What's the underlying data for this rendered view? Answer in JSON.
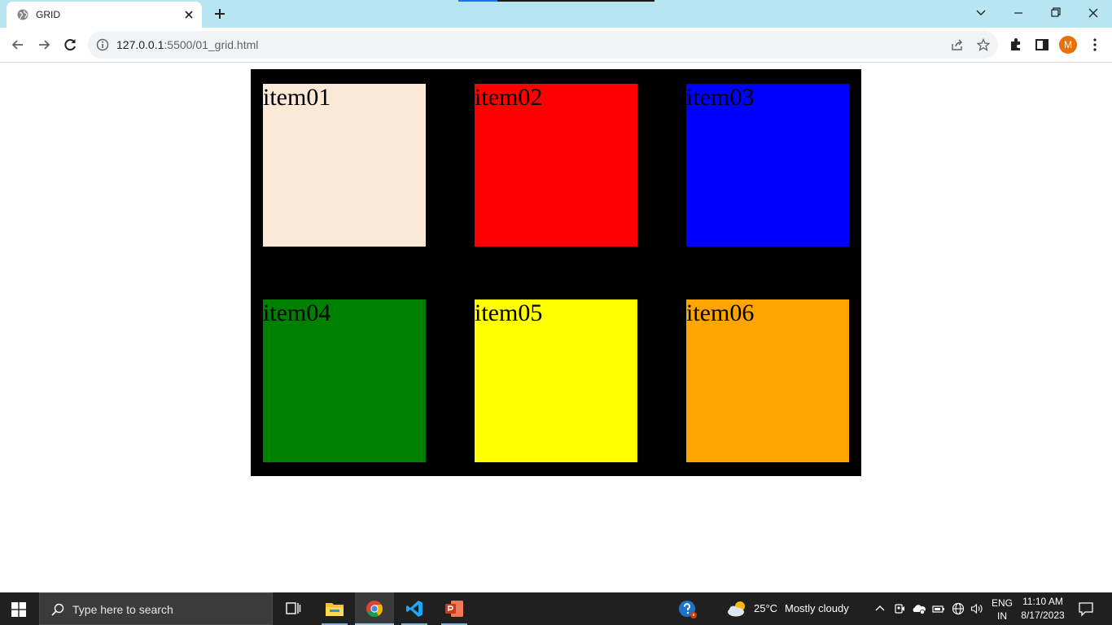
{
  "browser": {
    "tab_title": "GRID",
    "url_host": "127.0.0.1",
    "url_path": ":5500/01_grid.html",
    "profile_initial": "M"
  },
  "page": {
    "container_bg": "#000000",
    "items": [
      {
        "label": "item01",
        "color": "#fae9d6"
      },
      {
        "label": "item02",
        "color": "#ff0000"
      },
      {
        "label": "item03",
        "color": "#0000ff"
      },
      {
        "label": "item04",
        "color": "#008000"
      },
      {
        "label": "item05",
        "color": "#ffff00"
      },
      {
        "label": "item06",
        "color": "#ffa500"
      }
    ]
  },
  "taskbar": {
    "search_placeholder": "Type here to search",
    "weather_temp": "25°C",
    "weather_text": "Mostly cloudy",
    "lang_line1": "ENG",
    "lang_line2": "IN",
    "time": "11:10 AM",
    "date": "8/17/2023",
    "apps": [
      "task-view",
      "file-explorer",
      "chrome",
      "vscode",
      "powerpoint"
    ]
  }
}
